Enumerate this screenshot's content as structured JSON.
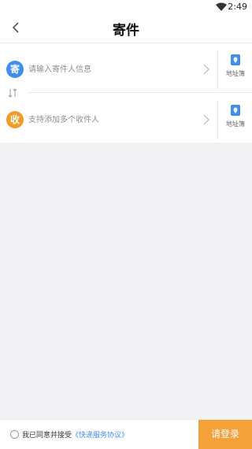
{
  "status_bar": {
    "time": "2:49",
    "wifi_icon": "wifi-icon"
  },
  "header": {
    "title": "寄件",
    "back_icon": "back-arrow-icon"
  },
  "sender": {
    "badge": "寄",
    "placeholder": "请输入寄件人信息",
    "address_book_label": "地址簿",
    "badge_color": "#3f8ef5"
  },
  "receiver": {
    "badge": "收",
    "placeholder": "支持添加多个收件人",
    "address_book_label": "地址簿",
    "badge_color": "#f59a23"
  },
  "swap_icon": "swap-icon",
  "footer": {
    "agree_prefix": "我已同意并接受",
    "agree_link": "《快递服务协议》",
    "login_label": "请登录",
    "login_color": "#f5a13a"
  }
}
